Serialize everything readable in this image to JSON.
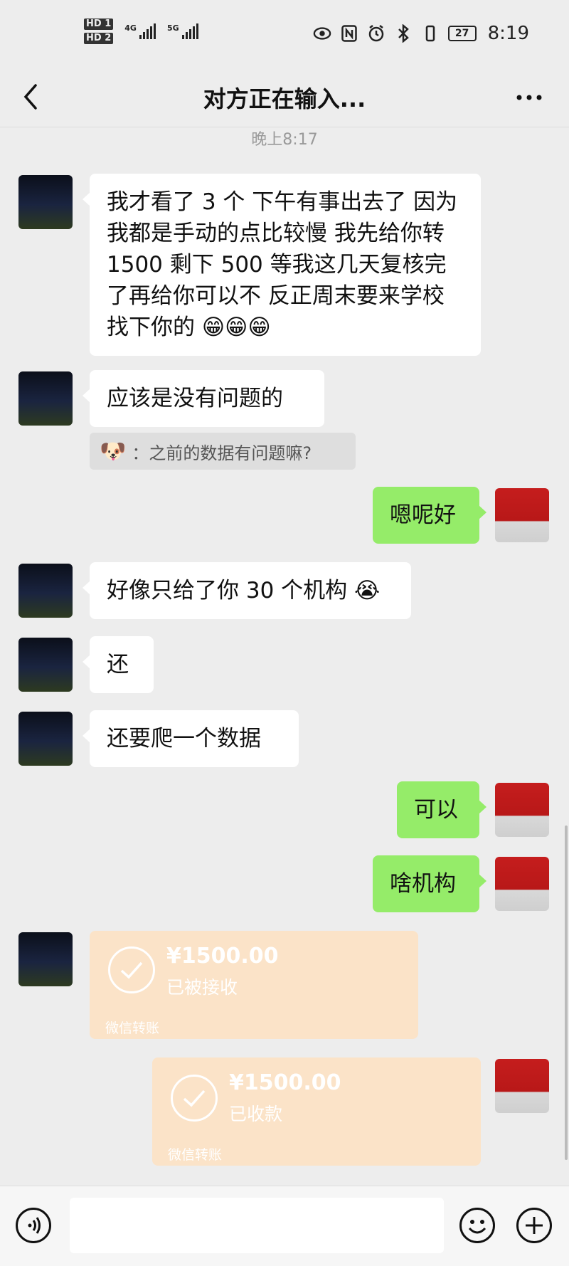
{
  "status_bar": {
    "hd1": "HD 1",
    "hd2": "HD 2",
    "net1": "4G",
    "net2": "5G",
    "battery": "27",
    "time": "8:19"
  },
  "header": {
    "title": "对方正在输入..."
  },
  "timestamp": "晚上8:17",
  "messages": [
    {
      "side": "left",
      "text": "我才看了 3 个 下午有事出去了 因为我都是手动的点比较慢 我先给你转 1500  剩下 500 等我这几天复核完了再给你可以不 反正周末要来学校找下你的 😁😁😁"
    },
    {
      "side": "left",
      "text": "应该是没有问题的"
    },
    {
      "side": "quote",
      "text": "：之前的数据有问题嘛?"
    },
    {
      "side": "right",
      "text": "嗯呢好"
    },
    {
      "side": "left",
      "text": "好像只给了你 30 个机构 😭"
    },
    {
      "side": "left",
      "text": "还"
    },
    {
      "side": "left",
      "text": "还要爬一个数据"
    },
    {
      "side": "right",
      "text": "可以"
    },
    {
      "side": "right",
      "text": "啥机构"
    }
  ],
  "transfers": [
    {
      "side": "left",
      "amount": "¥1500.00",
      "status": "已被接收",
      "label": "微信转账"
    },
    {
      "side": "right",
      "amount": "¥1500.00",
      "status": "已收款",
      "label": "微信转账"
    }
  ],
  "input": {
    "placeholder": ""
  },
  "colors": {
    "background": "#ededed",
    "bubble_self": "#95ec69",
    "bubble_other": "#ffffff",
    "transfer_done": "#fbe3c8"
  }
}
